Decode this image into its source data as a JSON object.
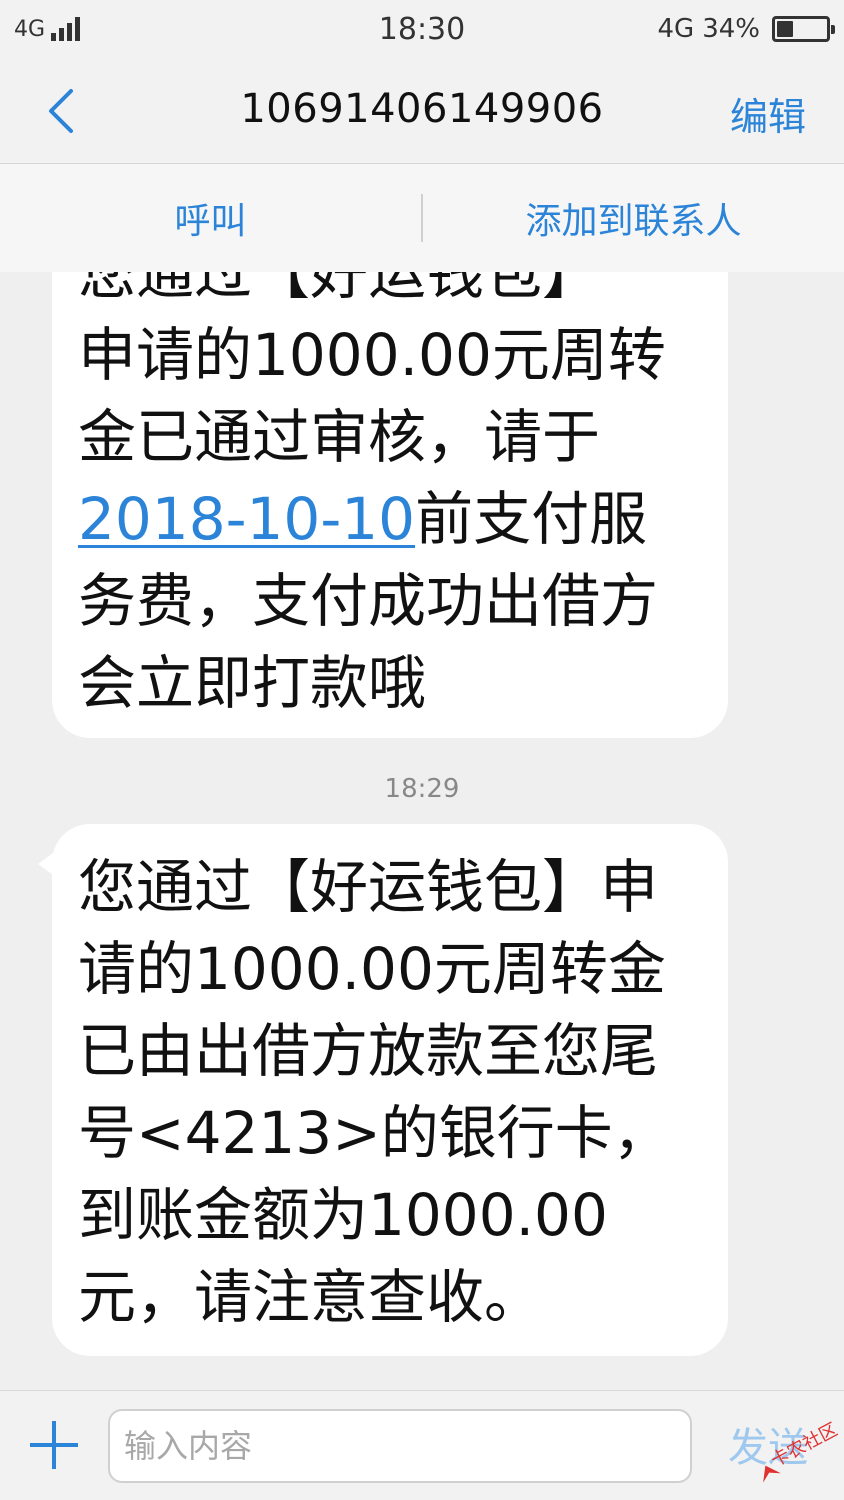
{
  "status_bar": {
    "network_left": "4G",
    "time": "18:30",
    "network_right": "4G",
    "battery_percent": "34%",
    "battery_level": 0.34
  },
  "header": {
    "title": "10691406149906",
    "edit_label": "编辑"
  },
  "actions": {
    "call_label": "呼叫",
    "add_contact_label": "添加到联系人"
  },
  "messages": [
    {
      "lines_before_link": [
        "您通过【好运钱包】",
        "申请的1000.00元周转",
        "金已通过审核，请于"
      ],
      "link": "2018-10-10",
      "line_after_link": "前支付服",
      "lines_after": [
        "务费，支付成功出借方",
        "会立即打款哦"
      ]
    },
    {
      "timestamp": "18:29",
      "lines": [
        "您通过【好运钱包】申",
        "请的1000.00元周转金",
        "已由出借方放款至您尾",
        "号<4213>的银行卡，",
        "到账金额为1000.00",
        "元，请注意查收。"
      ]
    }
  ],
  "input": {
    "placeholder": "输入内容",
    "send_label": "发送"
  },
  "watermark": {
    "text": "卡农社区"
  },
  "colors": {
    "accent": "#2b84d8",
    "background": "#efefef",
    "bubble": "#ffffff"
  }
}
